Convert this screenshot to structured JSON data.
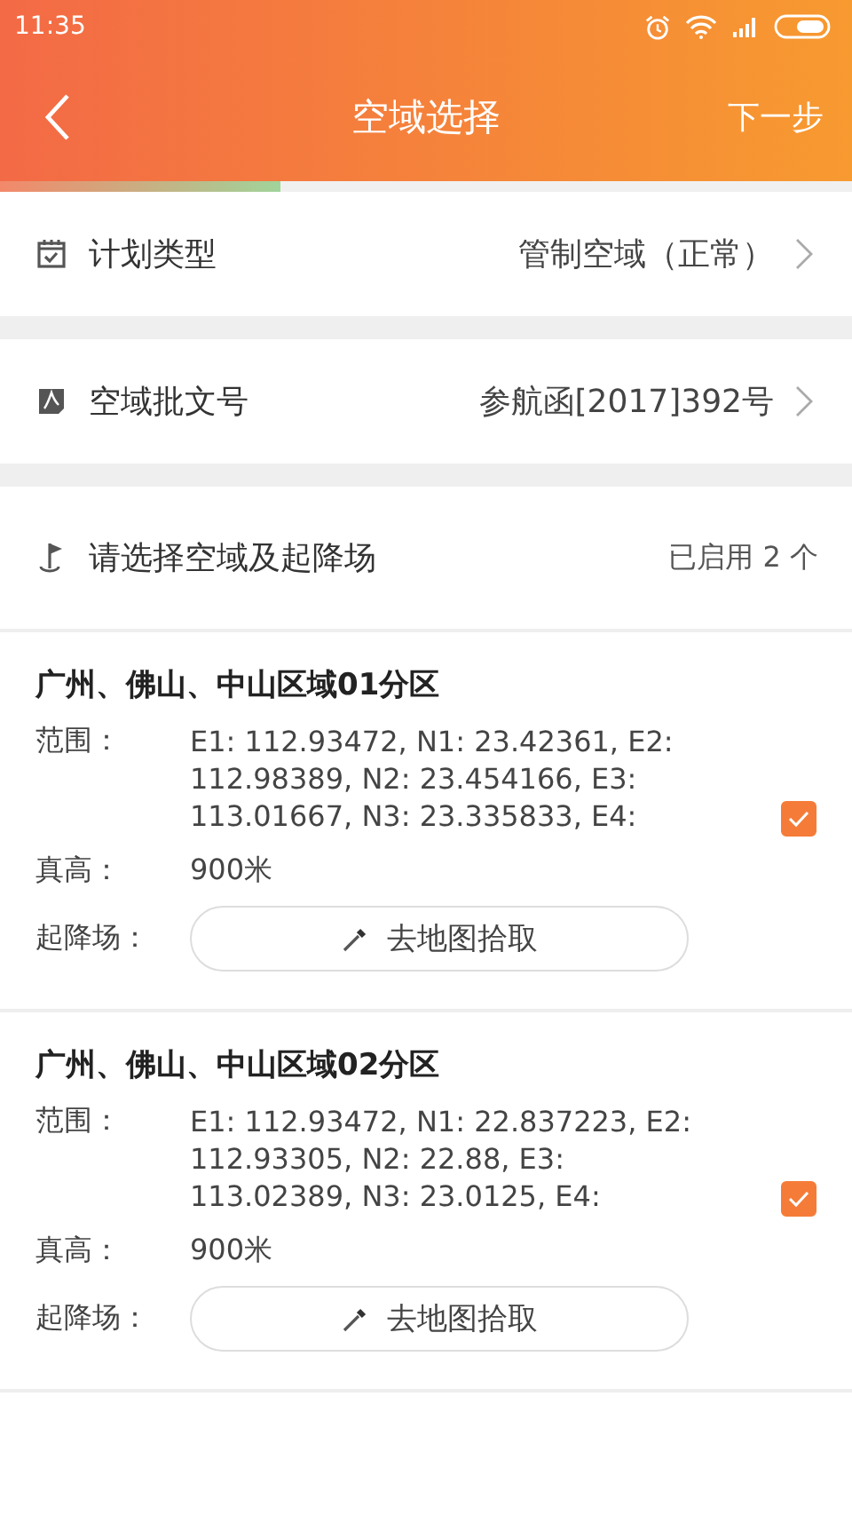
{
  "status_bar": {
    "time": "11:35"
  },
  "header": {
    "title": "空域选择",
    "next": "下一步"
  },
  "progress": {
    "level": 0.33
  },
  "fields": [
    {
      "kind": "plan",
      "label": "计划类型",
      "value": "管制空域（正常）"
    },
    {
      "kind": "doc",
      "label": "空域批文号",
      "value": "参航函[2017]392号"
    }
  ],
  "section": {
    "title": "请选择空域及起降场",
    "count": "已启用 2 个"
  },
  "zones": [
    {
      "name": "广州、佛山、中山区域01分区",
      "range_label": "范围：",
      "range": "E1: 112.93472, N1: 23.42361, E2: 112.98389, N2: 23.454166, E3: 113.01667, N3: 23.335833, E4:",
      "height_label": "真高：",
      "height": "900米",
      "airport_label": "起降场：",
      "pick_button": "去地图拾取",
      "checked": true
    },
    {
      "name": "广州、佛山、中山区域02分区",
      "range_label": "范围：",
      "range": "E1: 112.93472, N1: 22.837223, E2: 112.93305, N2: 22.88, E3: 113.02389, N3: 23.0125, E4:",
      "height_label": "真高：",
      "height": "900米",
      "airport_label": "起降场：",
      "pick_button": "去地图拾取",
      "checked": true
    }
  ]
}
